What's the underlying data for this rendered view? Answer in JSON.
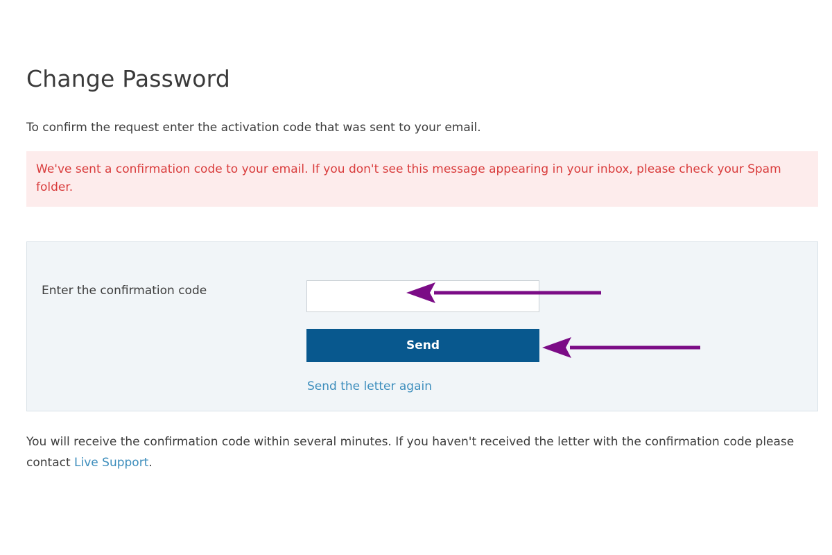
{
  "page": {
    "title": "Change Password",
    "intro": "To confirm the request enter the activation code that was sent to your email."
  },
  "alert": {
    "message": "We've sent a confirmation code to your email. If you don't see this message appearing in your inbox, please check your Spam folder.",
    "color": "#d93c3c",
    "background": "#fdecec"
  },
  "form": {
    "code_label": "Enter the confirmation code",
    "code_value": "",
    "code_placeholder": "",
    "send_label": "Send",
    "resend_label": "Send the letter again"
  },
  "footer": {
    "text_before": "You will receive the confirmation code within several minutes. If you haven't received the letter with the confirmation code please contact ",
    "support_link": "Live Support",
    "text_after": "."
  },
  "annotations": {
    "arrow_color": "#7b0c86",
    "arrow_icon": "left-arrow-icon"
  },
  "colors": {
    "primary_button": "#08588e",
    "link": "#3c8dbc"
  }
}
